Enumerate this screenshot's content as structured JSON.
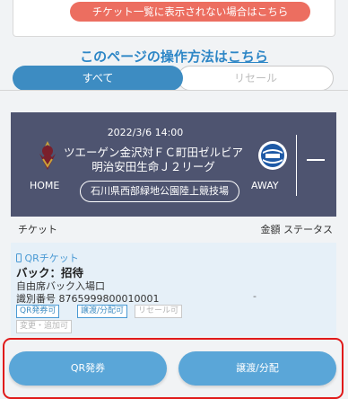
{
  "top": {
    "banner_text": "チケット一覧に表示されない場合はこちら"
  },
  "howto": {
    "prefix": "このページの操作方法は",
    "link": "こちら"
  },
  "tabs": [
    {
      "label": "すべて"
    },
    {
      "label": "リセール"
    }
  ],
  "match": {
    "date": "2022/3/6 14:00",
    "title_line1": "ツエーゲン金沢対ＦＣ町田ゼルビア",
    "title_line2": "明治安田生命Ｊ２リーグ",
    "home_label": "HOME",
    "away_label": "AWAY",
    "venue": "石川県西部緑地公園陸上競技場"
  },
  "list_header": {
    "ticket": "チケット",
    "amount_status": "金額 ステータス"
  },
  "ticket": {
    "type": "QRチケット",
    "name": "バック：招待",
    "gate": "自由席バック入場口",
    "id_label": "識別番号 8765999800010001",
    "bullet": "-",
    "tags": [
      {
        "label": "QR発券可"
      },
      {
        "label": "譲渡/分配可"
      },
      {
        "label": "リセール可"
      },
      {
        "label": "変更・追加可"
      }
    ]
  },
  "buttons": {
    "qr": "QR発券",
    "transfer": "譲渡/分配"
  },
  "colors": {
    "accent": "#3d8cc2",
    "banner": "#ec6e60",
    "match_bg": "#4e5470",
    "highlight": "#e01a1a"
  }
}
